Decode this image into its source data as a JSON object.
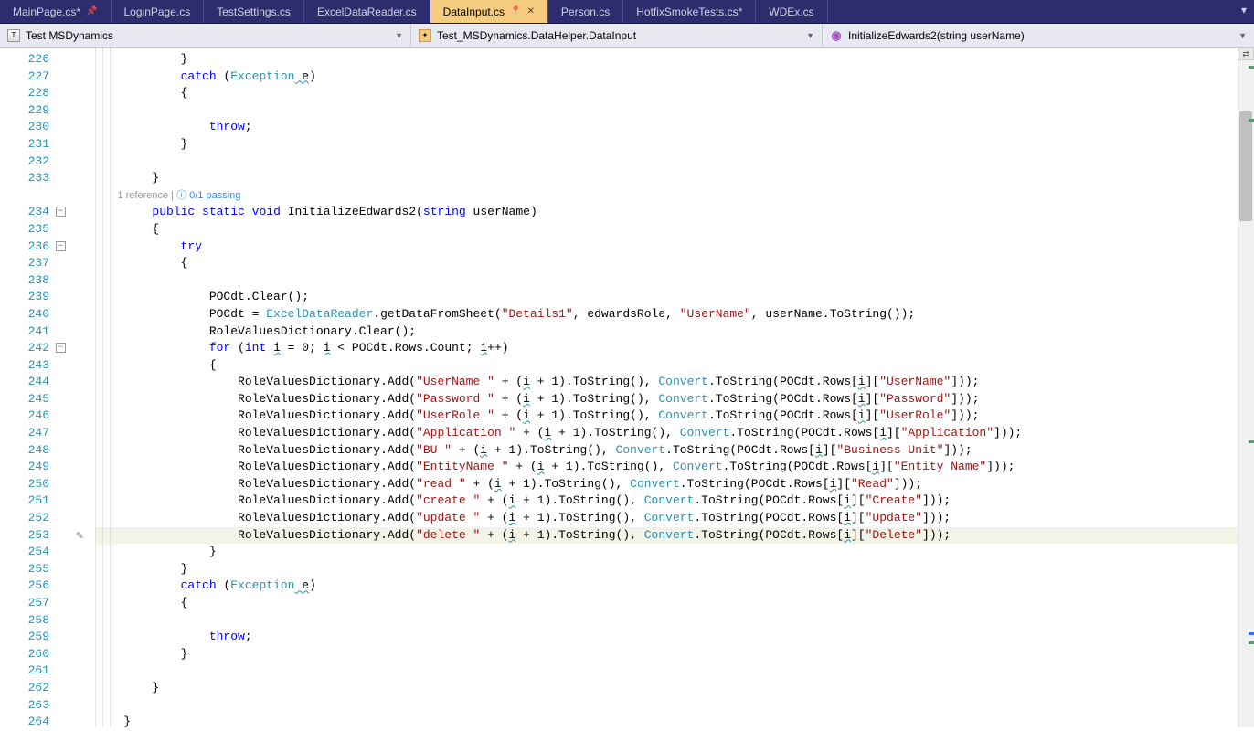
{
  "tabs": [
    {
      "label": "MainPage.cs*",
      "pinned": true
    },
    {
      "label": "LoginPage.cs"
    },
    {
      "label": "TestSettings.cs"
    },
    {
      "label": "ExcelDataReader.cs"
    },
    {
      "label": "DataInput.cs",
      "active": true,
      "pinnable": true,
      "closable": true
    },
    {
      "label": "Person.cs"
    },
    {
      "label": "HotfixSmokeTests.cs*"
    },
    {
      "label": "WDEx.cs"
    }
  ],
  "nav": {
    "project": "Test MSDynamics",
    "class": "Test_MSDynamics.DataHelper.DataInput",
    "member": "InitializeEdwards2(string userName)"
  },
  "codelens": {
    "refs": "1 reference",
    "pass": "0/1 passing"
  },
  "lines": {
    "start": 226,
    "end": 264
  },
  "code": {
    "l226": "            }",
    "l227_1": "catch",
    "l227_2": " (",
    "l227_3": "Exception",
    "l227_4": " e",
    "l227_5": ")",
    "l228": "            {",
    "l230": "throw",
    "l230b": ";",
    "l231": "            }",
    "l233": "        }",
    "l234_1": "public",
    "l234_2": "static",
    "l234_3": "void",
    "l234_4": " InitializeEdwards2(",
    "l234_5": "string",
    "l234_6": " userName)",
    "l235": "        {",
    "l236": "try",
    "l237": "            {",
    "l239": "                POCdt.Clear();",
    "l240_1": "                POCdt = ",
    "l240_2": "ExcelDataReader",
    "l240_3": ".getDataFromSheet(",
    "l240_4": "\"Details1\"",
    "l240_5": ", edwardsRole, ",
    "l240_6": "\"UserName\"",
    "l240_7": ", userName.ToString());",
    "l241": "                RoleValuesDictionary.Clear();",
    "l242_1": "for",
    "l242_2": " (",
    "l242_3": "int",
    "l242_4": " i",
    "l242_5": " = 0; i < POCdt.Rows.Count; i++)",
    "l243": "                {",
    "dict": [
      {
        "key": "\"UserName \"",
        "col": "\"UserName\""
      },
      {
        "key": "\"Password \"",
        "col": "\"Password\""
      },
      {
        "key": "\"UserRole \"",
        "col": "\"UserRole\""
      },
      {
        "key": "\"Application \"",
        "col": "\"Application\""
      },
      {
        "key": "\"BU \"",
        "col": "\"Business Unit\""
      },
      {
        "key": "\"EntityName \"",
        "col": "\"Entity Name\""
      },
      {
        "key": "\"read \"",
        "col": "\"Read\""
      },
      {
        "key": "\"create \"",
        "col": "\"Create\""
      },
      {
        "key": "\"update \"",
        "col": "\"Update\""
      },
      {
        "key": "\"delete \"",
        "col": "\"Delete\""
      }
    ],
    "l254": "                }",
    "l255": "            }",
    "l256_1": "catch",
    "l256_2": " (",
    "l256_3": "Exception",
    "l256_4": " e",
    "l256_5": ")",
    "l257": "            {",
    "l259": "throw",
    "l259b": ";",
    "l260": "            }",
    "l262": "        }",
    "l264": "    }"
  }
}
